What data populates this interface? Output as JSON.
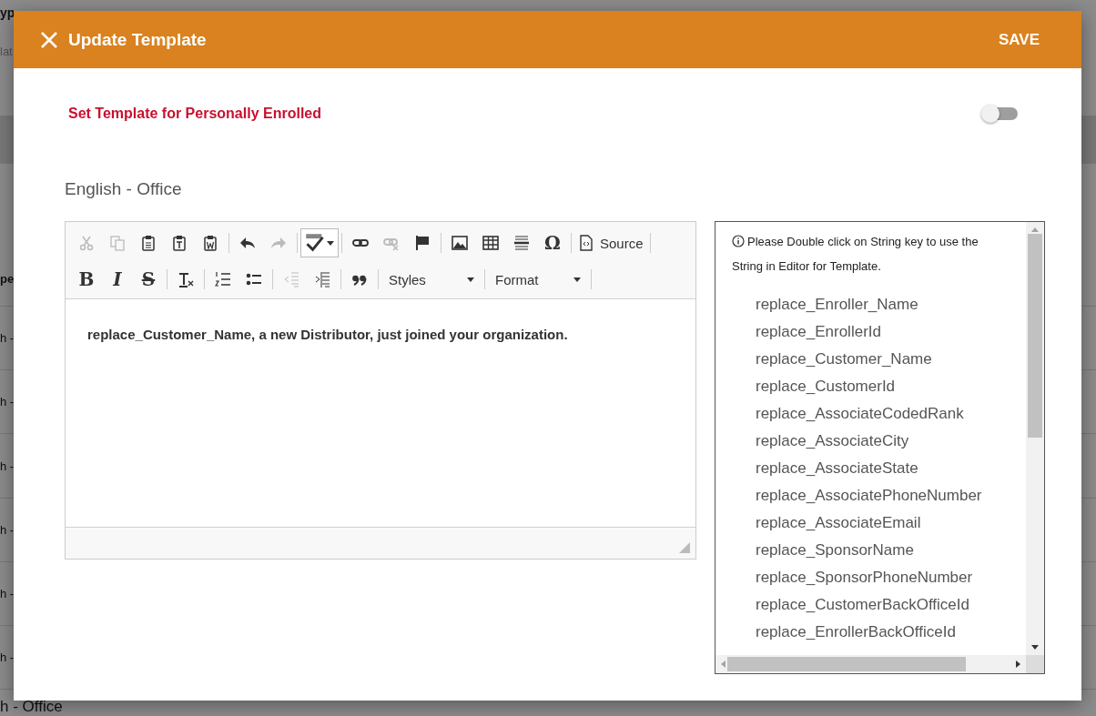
{
  "background": {
    "texts": [
      "yp",
      "lat",
      "pe",
      "h -",
      "h -",
      "h -",
      "h -",
      "h -",
      "h -",
      "h - Office"
    ]
  },
  "dialog": {
    "title": "Update Template",
    "save": "SAVE"
  },
  "personal": {
    "label": "Set Template for Personally Enrolled",
    "on": false
  },
  "section_title": "English - Office",
  "toolbar": {
    "rows": [
      [
        {
          "kind": "icon",
          "disabled": true
        },
        {
          "kind": "icon",
          "disabled": true
        },
        {
          "kind": "icon",
          "disabled": false
        },
        {
          "kind": "icon",
          "disabled": false
        },
        {
          "kind": "icon",
          "disabled": false
        },
        {
          "kind": "sep"
        },
        {
          "kind": "icon",
          "disabled": false
        },
        {
          "kind": "icon",
          "disabled": true
        },
        {
          "kind": "sep"
        },
        {
          "kind": "menu",
          "disabled": false
        },
        {
          "kind": "sep"
        },
        {
          "kind": "icon",
          "disabled": false
        },
        {
          "kind": "icon",
          "disabled": true
        },
        {
          "kind": "icon",
          "disabled": false
        },
        {
          "kind": "sep"
        },
        {
          "kind": "icon",
          "disabled": false
        },
        {
          "kind": "icon",
          "disabled": false
        },
        {
          "kind": "icon",
          "disabled": false
        },
        {
          "kind": "glyph",
          "glyph": "Ω",
          "disabled": false
        },
        {
          "kind": "sep"
        },
        {
          "kind": "text",
          "label": "Source",
          "disabled": false
        },
        {
          "kind": "sep"
        }
      ],
      [
        {
          "kind": "glyph",
          "glyph": "B",
          "disabled": false
        },
        {
          "kind": "glyph",
          "glyph": "I",
          "disabled": false
        },
        {
          "kind": "glyph",
          "glyph": "S",
          "disabled": false
        },
        {
          "kind": "sep"
        },
        {
          "kind": "icon",
          "disabled": false
        },
        {
          "kind": "sep"
        },
        {
          "kind": "icon",
          "disabled": false
        },
        {
          "kind": "icon",
          "disabled": false
        },
        {
          "kind": "sep"
        },
        {
          "kind": "icon",
          "disabled": true
        },
        {
          "kind": "icon",
          "disabled": false
        },
        {
          "kind": "sep"
        },
        {
          "kind": "icon",
          "disabled": false
        },
        {
          "kind": "sep"
        },
        {
          "kind": "combo",
          "label": "Styles"
        },
        {
          "kind": "sep"
        },
        {
          "kind": "combo",
          "label": "Format"
        },
        {
          "kind": "sep"
        }
      ]
    ]
  },
  "editor_text": "replace_Customer_Name, a new Distributor, just joined your organization.",
  "strings": {
    "hint": "Please Double click on String key to use the String in Editor for Template.",
    "items": [
      "replace_Enroller_Name",
      "replace_EnrollerId",
      "replace_Customer_Name",
      "replace_CustomerId",
      "replace_AssociateCodedRank",
      "replace_AssociateCity",
      "replace_AssociateState",
      "replace_AssociatePhoneNumber",
      "replace_AssociateEmail",
      "replace_SponsorName",
      "replace_SponsorPhoneNumber",
      "replace_CustomerBackOfficeId",
      "replace_EnrollerBackOfficeId"
    ]
  }
}
